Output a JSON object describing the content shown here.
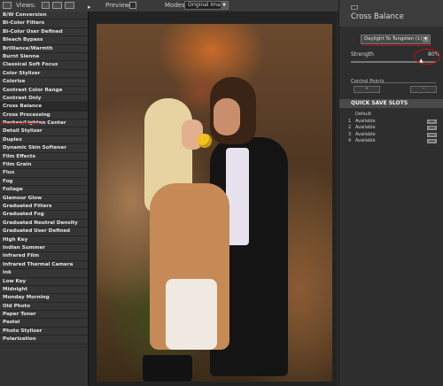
{
  "toolbar": {
    "views_label": "Views:",
    "preview_label": "Preview:",
    "modes_label": "Modes:",
    "modes_value": "Original Image"
  },
  "sidebar": {
    "items": [
      "B/W Conversion",
      "Bi-Color Filters",
      "Bi-Color User Defined",
      "Bleach Bypass",
      "Brilliance/Warmth",
      "Burnt Sienna",
      "Classical Soft Focus",
      "Color Stylizer",
      "Colorize",
      "Contrast Color Range",
      "Contrast Only",
      "Cross Balance",
      "Cross Processing",
      "Darken/Lighten Center",
      "Detail Stylizer",
      "Duplex",
      "Dynamic Skin Softener",
      "Film Effects",
      "Film Grain",
      "Flux",
      "Fog",
      "Foliage",
      "Glamour Glow",
      "Graduated Filters",
      "Graduated Fog",
      "Graduated Neutral Density",
      "Graduated User Defined",
      "High Key",
      "Indian Summer",
      "Infrared Film",
      "Infrared Thermal Camera",
      "Ink",
      "Low Key",
      "Midnight",
      "Monday Morning",
      "Old Photo",
      "Paper Toner",
      "Pastel",
      "Photo Stylizer",
      "Polarization"
    ],
    "selected": "Cross Balance",
    "highlight_color": "#c00d0d"
  },
  "panel": {
    "title": "Cross Balance",
    "preset_value": "Daylight To Tungsten (1)",
    "strength_label": "Strength",
    "strength_value": "80%",
    "control_points_label": "Control Points",
    "quick_save_header": "QUICK SAVE SLOTS",
    "slots": [
      {
        "num": "",
        "label": "Default"
      },
      {
        "num": "1",
        "label": "Available"
      },
      {
        "num": "2",
        "label": "Available"
      },
      {
        "num": "3",
        "label": "Available"
      },
      {
        "num": "4",
        "label": "Available"
      }
    ],
    "slot_button": "Set"
  }
}
